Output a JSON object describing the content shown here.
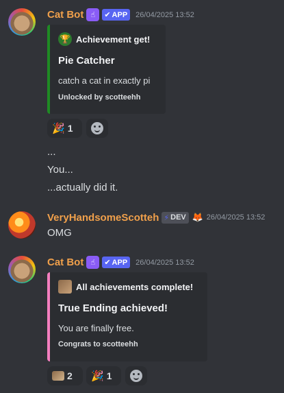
{
  "messages": [
    {
      "author": "Cat Bot",
      "badge": "APP",
      "timestamp": "26/04/2025 13:52",
      "embed": {
        "author": "Achievement get!",
        "title": "Pie Catcher",
        "description": "catch a cat in exactly pi",
        "footer": "Unlocked by scotteehh",
        "accent": "#1f8b24"
      },
      "reactions": [
        {
          "emoji": "🎉",
          "count": "1"
        }
      ],
      "lines": [
        "...",
        "You...",
        "...actually did it."
      ]
    },
    {
      "author": "VeryHandsomeScotteh",
      "badge": "DEV",
      "timestamp": "26/04/2025 13:52",
      "text": "OMG"
    },
    {
      "author": "Cat Bot",
      "badge": "APP",
      "timestamp": "26/04/2025 13:52",
      "embed": {
        "author": "All achievements complete!",
        "title": "True Ending achieved!",
        "description": "You are finally free.",
        "footer": "Congrats to scotteehh",
        "accent": "#f47fbf"
      },
      "reactions": [
        {
          "emoji": "cat",
          "count": "2"
        },
        {
          "emoji": "🎉",
          "count": "1"
        }
      ]
    }
  ],
  "icons": {
    "bot_badge": "hand-pointing-icon",
    "check": "checkmark-icon",
    "dev_badge": "lightning-icon",
    "fox": "fox-icon",
    "trophy": "trophy-icon",
    "add_reaction": "smiley-icon"
  }
}
